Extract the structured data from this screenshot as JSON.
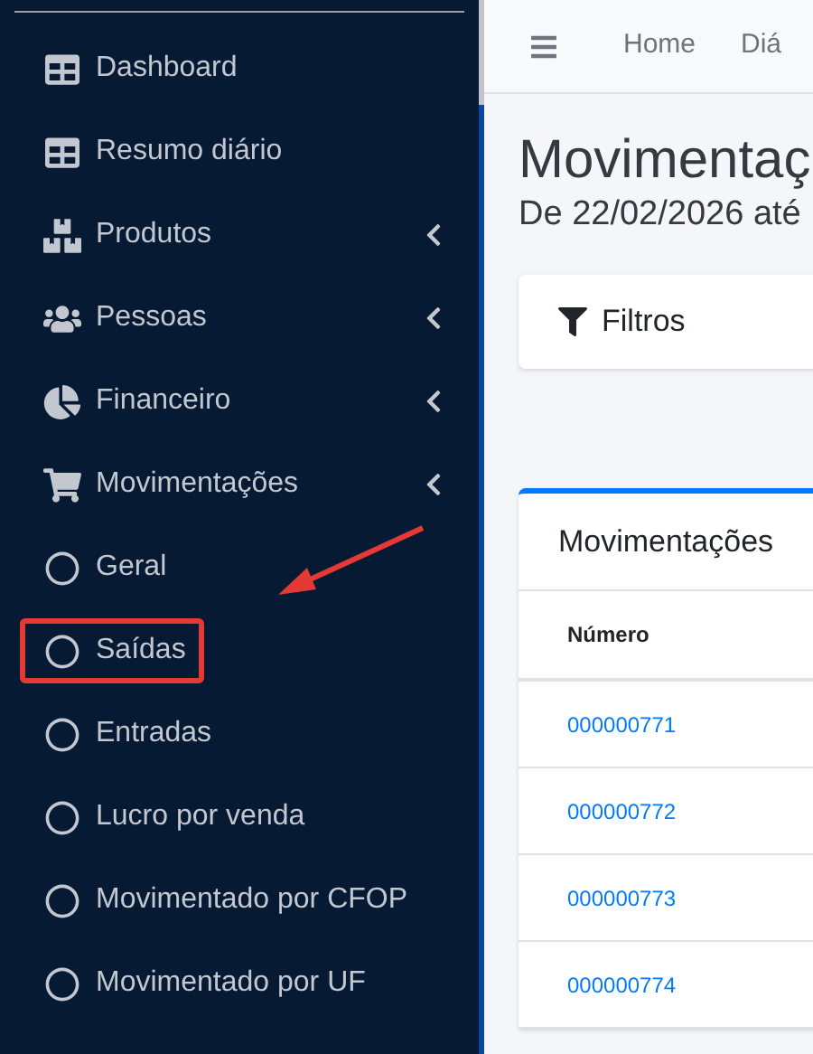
{
  "sidebar": {
    "items": [
      {
        "label": "Dashboard",
        "kind": "link"
      },
      {
        "label": "Resumo diário",
        "kind": "link"
      },
      {
        "label": "Produtos",
        "kind": "menu"
      },
      {
        "label": "Pessoas",
        "kind": "menu"
      },
      {
        "label": "Financeiro",
        "kind": "menu"
      },
      {
        "label": "Movimentações",
        "kind": "menu",
        "children": [
          {
            "label": "Geral",
            "highlighted": false
          },
          {
            "label": "Saídas",
            "highlighted": true
          },
          {
            "label": "Entradas",
            "highlighted": false
          },
          {
            "label": "Lucro por venda",
            "highlighted": false
          },
          {
            "label": "Movimentado por CFOP",
            "highlighted": false
          },
          {
            "label": "Movimentado por UF",
            "highlighted": false
          }
        ]
      }
    ]
  },
  "navbar": {
    "links": [
      "Home",
      "Diá"
    ]
  },
  "page": {
    "title": "Movimentaç",
    "subtitle": "De 22/02/2026 até"
  },
  "filters": {
    "label": "Filtros"
  },
  "table_card": {
    "title": "Movimentações",
    "columns": [
      "Número"
    ],
    "rows": [
      [
        "000000771"
      ],
      [
        "000000772"
      ],
      [
        "000000773"
      ],
      [
        "000000774"
      ]
    ]
  }
}
